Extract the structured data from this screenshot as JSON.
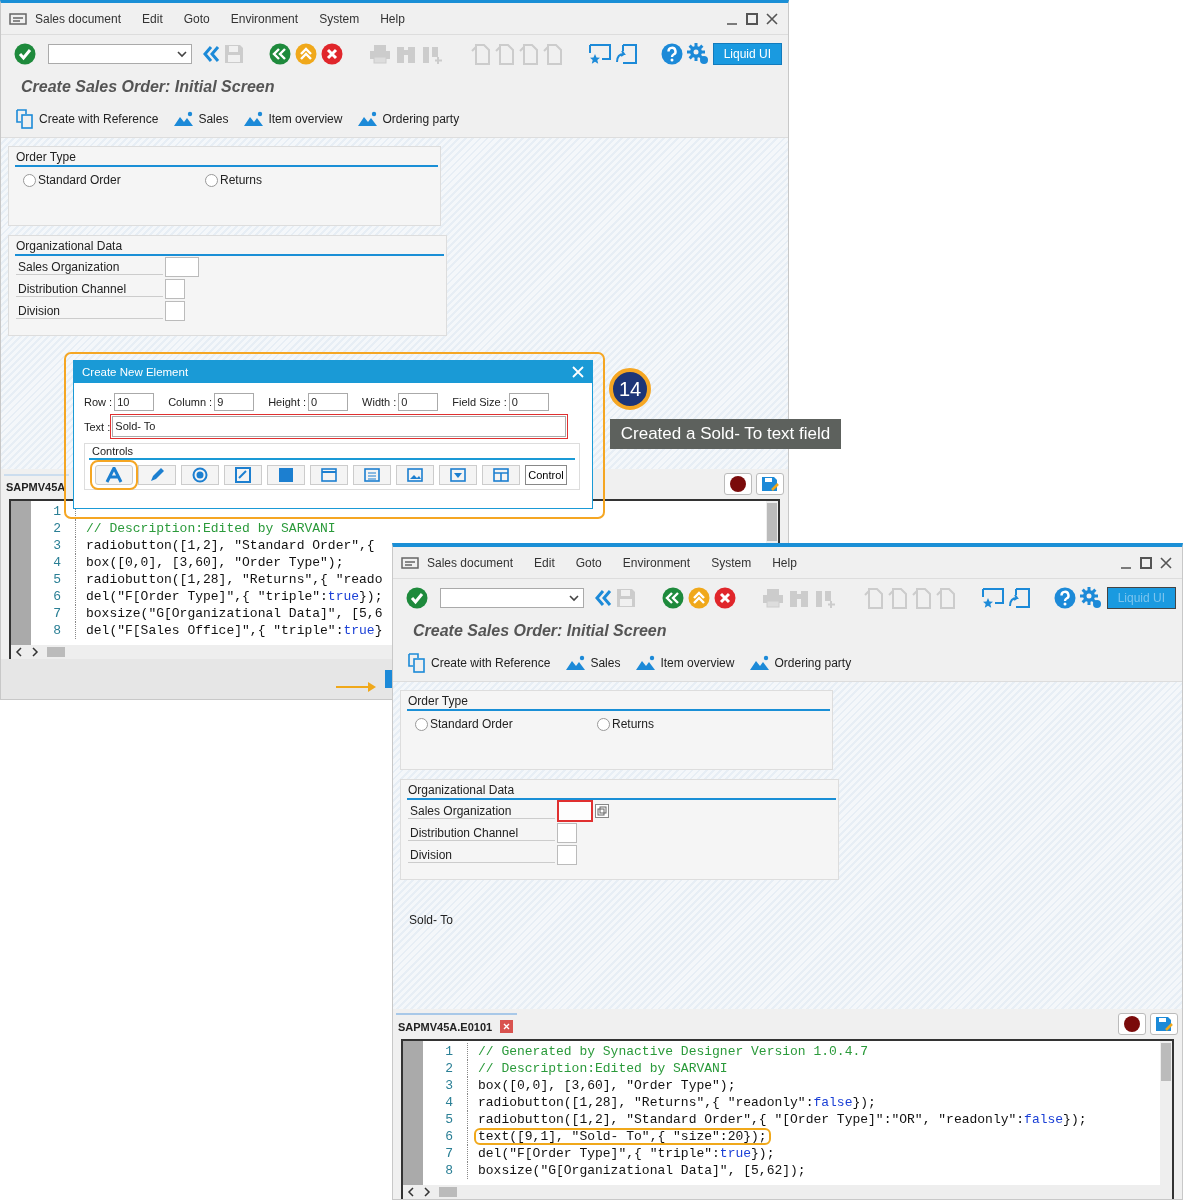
{
  "windows": [
    {
      "menu": [
        "Sales document",
        "Edit",
        "Goto",
        "Environment",
        "System",
        "Help"
      ],
      "liquid_button": {
        "label": "Liquid UI",
        "disabled": false
      },
      "title": "Create Sales Order: Initial Screen",
      "nav": [
        {
          "label": "Create with Reference",
          "kind": "reference"
        },
        {
          "label": "Sales",
          "kind": "overview"
        },
        {
          "label": "Item overview",
          "kind": "overview"
        },
        {
          "label": "Ordering party",
          "kind": "overview"
        }
      ],
      "order_type": {
        "title": "Order Type",
        "radios": [
          {
            "label": "Standard Order",
            "selected": false
          },
          {
            "label": "Returns",
            "selected": false
          }
        ]
      },
      "org_data": {
        "title": "Organizational Data",
        "fields": [
          {
            "label": "Sales Organization",
            "selected": false
          },
          {
            "label": "Distribution Channel",
            "selected": false
          },
          {
            "label": "Division",
            "selected": false
          }
        ]
      },
      "script_tab": {
        "label": "SAPMV45A"
      },
      "code_lines": [
        {
          "n": "1"
        },
        {
          "n": "2",
          "text": "// Description:Edited by SARVANI",
          "kind": "comment",
          "highlighted": false
        },
        {
          "n": "3",
          "text": "radiobutton([1,2], \"Standard Order\",{",
          "kind": "code",
          "highlighted": false
        },
        {
          "n": "4",
          "text": "box([0,0], [3,60], \"Order Type\");",
          "kind": "code",
          "highlighted": false
        },
        {
          "n": "5",
          "text": "radiobutton([1,28], \"Returns\",{ \"reado",
          "kind": "code",
          "highlighted": false
        },
        {
          "n": "6",
          "text": "del(\"F[Order Type]\",{ \"triple\":true});",
          "kind": "code",
          "highlighted": false
        },
        {
          "n": "7",
          "text": "boxsize(\"G[Organizational Data]\", [5,6",
          "kind": "code",
          "highlighted": false
        },
        {
          "n": "8",
          "text": "del(\"F[Sales Office]\",{ \"triple\":true}",
          "kind": "code",
          "highlighted": false
        }
      ],
      "status_bar": true
    },
    {
      "menu": [
        "Sales document",
        "Edit",
        "Goto",
        "Environment",
        "System",
        "Help"
      ],
      "liquid_button": {
        "label": "Liquid UI",
        "disabled": true
      },
      "title": "Create Sales Order: Initial Screen",
      "nav": [
        {
          "label": "Create with Reference",
          "kind": "reference"
        },
        {
          "label": "Sales",
          "kind": "overview"
        },
        {
          "label": "Item overview",
          "kind": "overview"
        },
        {
          "label": "Ordering party",
          "kind": "overview"
        }
      ],
      "order_type": {
        "title": "Order Type",
        "radios": [
          {
            "label": "Standard Order",
            "selected": false
          },
          {
            "label": "Returns",
            "selected": false
          }
        ]
      },
      "org_data": {
        "title": "Organizational Data",
        "fields": [
          {
            "label": "Sales Organization",
            "selected": true
          },
          {
            "label": "Distribution Channel",
            "selected": false
          },
          {
            "label": "Division",
            "selected": false
          }
        ]
      },
      "extra_text": "Sold- To",
      "script_tab": {
        "label": "SAPMV45A.E0101",
        "closable": true
      },
      "code_lines": [
        {
          "n": "1",
          "text": "// Generated by Synactive Designer Version 1.0.4.7",
          "kind": "comment",
          "highlighted": false
        },
        {
          "n": "2",
          "text": "// Description:Edited by SARVANI",
          "kind": "comment",
          "highlighted": false
        },
        {
          "n": "3",
          "text": "box([0,0], [3,60], \"Order Type\");",
          "kind": "code",
          "highlighted": false
        },
        {
          "n": "4",
          "text": "radiobutton([1,28], \"Returns\",{ \"readonly\":false});",
          "kind": "code",
          "highlighted": false
        },
        {
          "n": "5",
          "text": "radiobutton([1,2], \"Standard Order\",{ \"[Order Type]\":\"OR\", \"readonly\":false});",
          "kind": "code",
          "highlighted": false
        },
        {
          "n": "6",
          "text": "text([9,1], \"Sold- To\",{ \"size\":20});",
          "kind": "code",
          "highlighted": true
        },
        {
          "n": "7",
          "text": "del(\"F[Order Type]\",{ \"triple\":true});",
          "kind": "code",
          "highlighted": false
        },
        {
          "n": "8",
          "text": "boxsize(\"G[Organizational Data]\", [5,62]);",
          "kind": "code",
          "highlighted": false
        }
      ],
      "status_bar": false
    }
  ],
  "dialog": {
    "title": "Create New Element",
    "params": [
      {
        "label": "Row :",
        "value": "10"
      },
      {
        "label": "Column :",
        "value": "9"
      },
      {
        "label": "Height :",
        "value": "0"
      },
      {
        "label": "Width :",
        "value": "0"
      },
      {
        "label": "Field Size :",
        "value": "0"
      }
    ],
    "text_label": "Text :",
    "text_value": "Sold- To",
    "controls_title": "Controls",
    "controls": [
      {
        "kind": "text",
        "selected": true
      },
      {
        "kind": "edit",
        "selected": false
      },
      {
        "kind": "radio",
        "selected": false
      },
      {
        "kind": "check",
        "selected": false
      },
      {
        "kind": "box",
        "selected": false
      },
      {
        "kind": "window",
        "selected": false
      },
      {
        "kind": "list",
        "selected": false
      },
      {
        "kind": "image",
        "selected": false
      },
      {
        "kind": "dropdown",
        "selected": false
      },
      {
        "kind": "table",
        "selected": false
      },
      {
        "kind": "more",
        "label": "Control",
        "selected": false
      }
    ]
  },
  "callout": {
    "step": "14",
    "caption": "Created a Sold- To text field"
  }
}
